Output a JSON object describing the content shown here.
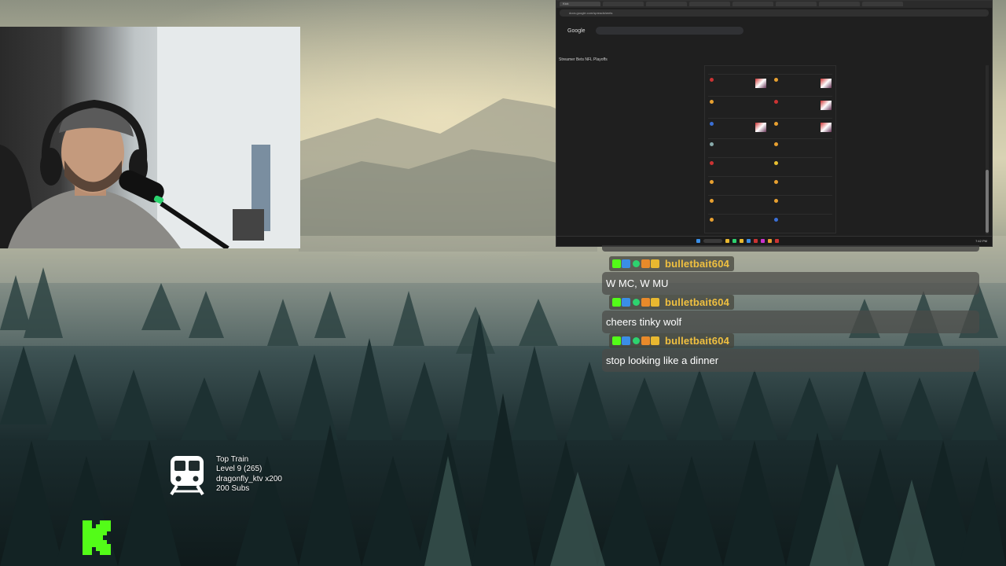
{
  "browser": {
    "tabs": [
      "Kick",
      "",
      "",
      "",
      "",
      "",
      "",
      ""
    ],
    "url": "docs.google.com/spreadsheets",
    "search_logo": "Google",
    "search_value": ""
  },
  "sheet": {
    "title": "Streamer Bets NFL Playoffs"
  },
  "taskbar": {
    "clock": "7:42 PM"
  },
  "chat": {
    "messages": [
      {
        "username": "bulletbait604",
        "text": "W MC, W MU"
      },
      {
        "username": "bulletbait604",
        "text": "cheers tinky wolf"
      },
      {
        "username": "bulletbait604",
        "text": "stop looking like a dinner"
      }
    ]
  },
  "top_train": {
    "title": "Top Train",
    "level": "Level 9  (265)",
    "contributor": "dragonfly_ktv x200",
    "subs": "200 Subs",
    "icon": "train-icon"
  },
  "brand": {
    "logo": "kick-logo",
    "accent": "#53fc18"
  }
}
